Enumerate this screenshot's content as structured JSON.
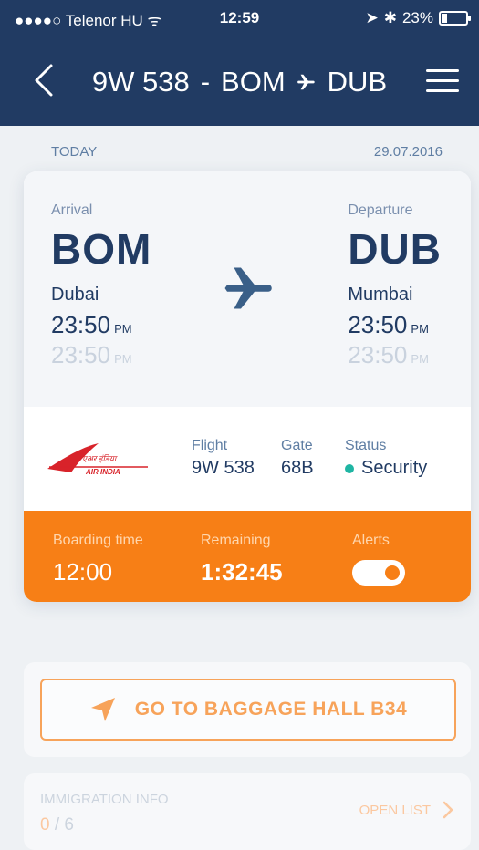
{
  "status_bar": {
    "carrier": "●●●●○ Telenor HU ᯤ",
    "time": "12:59",
    "battery": "23%",
    "battery_level": 0.23
  },
  "header": {
    "flight_code": "9W 538",
    "separator": "-",
    "from": "BOM",
    "to": "DUB"
  },
  "date_row": {
    "label": "TODAY",
    "date": "29.07.2016"
  },
  "flight": {
    "arrival_label": "Arrival",
    "arrival_code": "BOM",
    "arrival_city": "Dubai",
    "arrival_time": "23:50",
    "arrival_time_suffix": "PM",
    "arrival_sched_time": "23:50",
    "arrival_sched_suffix": "PM",
    "departure_label": "Departure",
    "departure_code": "DUB",
    "departure_city": "Mumbai",
    "departure_time": "23:50",
    "departure_time_suffix": "PM",
    "departure_sched_time": "23:50",
    "departure_sched_suffix": "PM"
  },
  "details": {
    "flight_label": "Flight",
    "flight_value": "9W 538",
    "gate_label": "Gate",
    "gate_value": "68B",
    "status_label": "Status",
    "status_value": "Security",
    "status_color": "#1fb5a3",
    "airline_logo_text_line1": "एअर इंडिया",
    "airline_logo_text_line2": "AIR INDIA"
  },
  "boarding": {
    "boarding_label": "Boarding time",
    "boarding_value": "12:00",
    "remaining_label": "Remaining",
    "remaining_value": "1:32:45",
    "alerts_label": "Alerts",
    "alerts_on": true,
    "accent": "#f77f16"
  },
  "actions": {
    "baggage_label": "GO TO BAGGAGE HALL B34"
  },
  "immigration": {
    "title": "IMMIGRATION INFO",
    "done": "0",
    "separator": " / ",
    "total": "6",
    "open_list": "OPEN LIST"
  },
  "icons": {
    "back": "chevron-left-icon",
    "menu": "hamburger-menu-icon",
    "plane": "airplane-icon",
    "navigate": "location-arrow-icon",
    "chevron": "chevron-right-icon"
  }
}
